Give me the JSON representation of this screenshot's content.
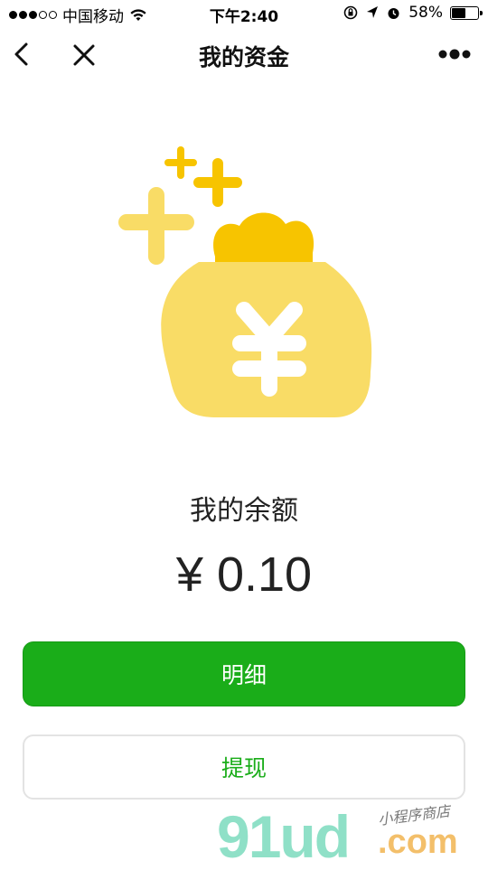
{
  "status_bar": {
    "carrier": "中国移动",
    "time": "下午2:40",
    "battery_percent": "58%",
    "signal_bars_filled": 3,
    "signal_bars_total": 5,
    "battery_level": 0.58,
    "icons": [
      "wifi-icon",
      "orientation-lock-icon",
      "location-icon",
      "alarm-icon",
      "battery-icon"
    ]
  },
  "nav": {
    "title": "我的资金",
    "back_icon": "chevron-left-icon",
    "close_icon": "close-icon",
    "more_icon": "more-dots-icon"
  },
  "wallet": {
    "illustration_icon": "money-bag-icon",
    "balance_label": "我的余额",
    "balance_amount": "¥ 0.10"
  },
  "actions": {
    "details_label": "明细",
    "withdraw_label": "提现"
  },
  "watermark": {
    "logo_text": "91ud",
    "domain_text": ".com",
    "tagline": "小程序商店"
  },
  "colors": {
    "primary_green": "#1aad19",
    "bag_light_yellow": "#f9dc66",
    "bag_dark_yellow": "#f7c400",
    "plus_yellow": "#f7c400",
    "plus_light_yellow": "#f9dc66"
  }
}
